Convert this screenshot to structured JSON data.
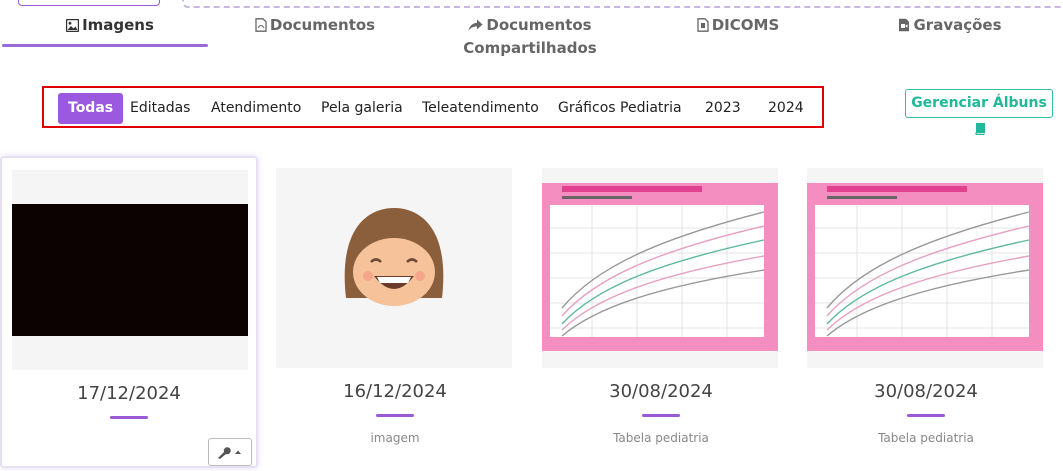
{
  "main_tabs": [
    {
      "label": "Imagens",
      "icon": "image-icon",
      "active": true
    },
    {
      "label": "Documentos",
      "icon": "pdf-file-icon",
      "active": false
    },
    {
      "label": "Documentos Compartilhados",
      "icon": "share-arrow-icon",
      "active": false
    },
    {
      "label": "DICOMS",
      "icon": "dicom-file-icon",
      "active": false
    },
    {
      "label": "Gravações",
      "icon": "video-file-icon",
      "active": false
    }
  ],
  "filters": [
    "Todas",
    "Editadas",
    "Atendimento",
    "Pela galeria",
    "Teleatendimento",
    "Gráficos Pediatria",
    "2023",
    "2024"
  ],
  "active_filter": "Todas",
  "manage_albums": {
    "label": "Gerenciar Álbuns",
    "icon": "book-icon"
  },
  "cards": [
    {
      "date": "17/12/2024",
      "caption": "",
      "thumb": "black-image",
      "selected": true
    },
    {
      "date": "16/12/2024",
      "caption": "imagem",
      "thumb": "smiling-face-avatar"
    },
    {
      "date": "30/08/2024",
      "caption": "Tabela pediatria",
      "thumb": "growth-chart"
    },
    {
      "date": "30/08/2024",
      "caption": "Tabela pediatria",
      "thumb": "growth-chart"
    }
  ],
  "colors": {
    "accent": "#9b59e0",
    "teal": "#2fbfa2",
    "highlight_border": "#e00000",
    "chart_pink": "#f06aa8"
  }
}
